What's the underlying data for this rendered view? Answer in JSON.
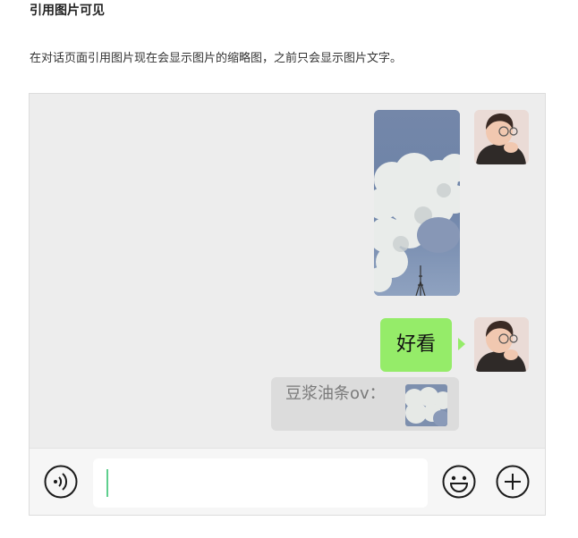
{
  "heading": "引用图片可见",
  "description": "在对话页面引用图片现在会显示图片的缩略图，之前只会显示图片文字。",
  "chat": {
    "message_text": "好看",
    "quote": {
      "text": "豆浆油条ov："
    }
  },
  "input_bar": {
    "input_value": "",
    "icons": [
      "voice-icon",
      "emoji-icon",
      "plus-icon"
    ]
  },
  "colors": {
    "chat_background": "#ededed",
    "bubble_green": "#95ec69",
    "quote_background": "#dcdcdc",
    "caret": "#5fcf8e"
  }
}
